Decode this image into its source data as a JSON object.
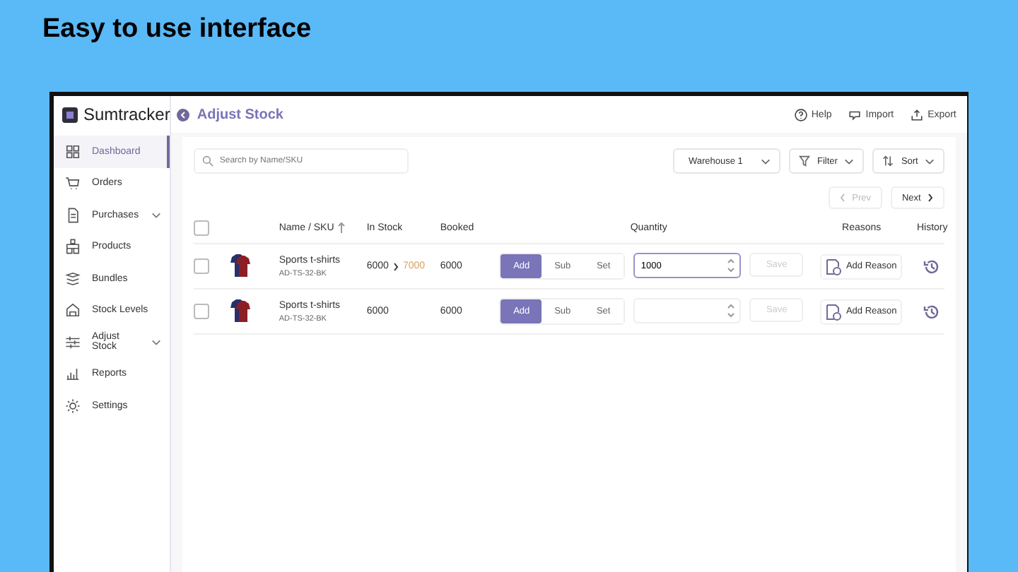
{
  "slide_title": "Easy to use interface",
  "app": {
    "logo": "Sumtracker",
    "page_title": "Adjust Stock",
    "header_actions": [
      {
        "label": "Help",
        "kind": "help"
      },
      {
        "label": "Import",
        "kind": "import"
      },
      {
        "label": "Export",
        "kind": "export"
      }
    ]
  },
  "sidebar": {
    "items": [
      {
        "label": "Dashboard",
        "kind": "dashboard",
        "selected": true,
        "expandable": false
      },
      {
        "label": "Orders",
        "kind": "orders",
        "selected": false,
        "expandable": false
      },
      {
        "label": "Purchases",
        "kind": "purchases",
        "selected": false,
        "expandable": true
      },
      {
        "label": "Products",
        "kind": "products",
        "selected": false,
        "expandable": false
      },
      {
        "label": "Bundles",
        "kind": "bundles",
        "selected": false,
        "expandable": false
      },
      {
        "label": "Stock Levels",
        "kind": "stock",
        "selected": false,
        "expandable": false
      },
      {
        "label": "Adjust Stock",
        "kind": "adjust",
        "selected": false,
        "expandable": true
      },
      {
        "label": "Reports",
        "kind": "reports",
        "selected": false,
        "expandable": false
      },
      {
        "label": "Settings",
        "kind": "settings",
        "selected": false,
        "expandable": false
      }
    ]
  },
  "toolbar": {
    "search": {
      "placeholder": "Search by Name/SKU"
    },
    "warehouse": "Warehouse 1",
    "filter": "Filter",
    "sort": "Sort"
  },
  "pagination": {
    "prev": {
      "label": "Prev",
      "disabled": true
    },
    "next": {
      "label": "Next",
      "disabled": false
    }
  },
  "table": {
    "select_all_checked": false,
    "columns": [
      "Name / SKU",
      "In Stock",
      "Booked",
      "Quantity",
      "Reasons",
      "History"
    ],
    "rows": [
      {
        "checked": false,
        "name": "Sports t-shirts",
        "sku": "AD-TS-32-BK",
        "in_stock": "6000",
        "new_stock": "7000",
        "booked": "6000",
        "modes": [
          {
            "label": "Add",
            "selected": true
          },
          {
            "label": "Sub",
            "selected": false
          },
          {
            "label": "Set",
            "selected": false
          }
        ],
        "quantity": "1000",
        "save": {
          "label": "Save",
          "disabled": true
        },
        "reason": "Add Reason"
      },
      {
        "checked": false,
        "name": "Sports t-shirts",
        "sku": "AD-TS-32-BK",
        "in_stock": "6000",
        "booked": "6000",
        "modes": [
          {
            "label": "Add",
            "selected": true
          },
          {
            "label": "Sub",
            "selected": false
          },
          {
            "label": "Set",
            "selected": false
          }
        ],
        "quantity": "",
        "save": {
          "label": "Save",
          "disabled": true
        },
        "reason": "Add Reason"
      }
    ]
  }
}
